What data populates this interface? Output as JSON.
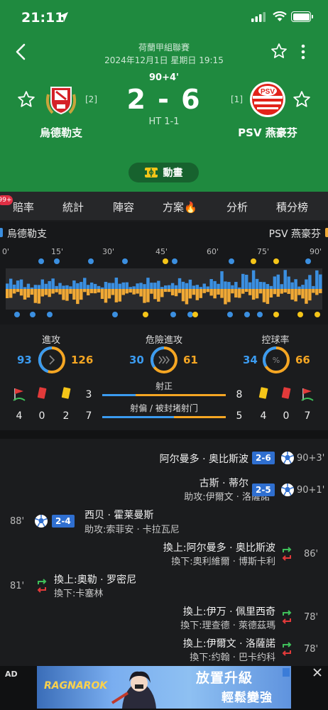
{
  "status_bar": {
    "time": "21:11"
  },
  "match": {
    "competition": "荷蘭甲組聯賽",
    "datetime": "2024年12月1日 星期日 19:15",
    "minute": "90+4'",
    "score": "2 - 6",
    "halftime": "HT 1-1",
    "home": {
      "name": "烏德勒支",
      "rank": "[2]"
    },
    "away": {
      "name": "PSV 燕豪芬",
      "rank": "[1]"
    },
    "animation_label": "動畫"
  },
  "tabs": {
    "badge": "99+",
    "items": [
      "賠率",
      "統計",
      "陣容",
      "方案🔥",
      "分析",
      "積分榜"
    ]
  },
  "timeline": {
    "home_label": "烏德勒支",
    "away_label": "PSV 燕豪芬",
    "ticks": [
      "0'",
      "15'",
      "30'",
      "45'",
      "60'",
      "75'",
      "90'"
    ]
  },
  "stats": {
    "attack": {
      "label": "進攻",
      "home": "93",
      "away": "126"
    },
    "dangerous": {
      "label": "危險進攻",
      "home": "30",
      "away": "61"
    },
    "possession": {
      "label": "控球率",
      "home": "34",
      "away": "66"
    },
    "on_target": {
      "label": "射正",
      "home": "3",
      "away": "8",
      "home_share": 0.27
    },
    "off_target": {
      "label": "射偏 / 被封堵射门",
      "home": "7",
      "away": "5",
      "home_share": 0.58
    },
    "home_cards": {
      "corners": "4",
      "red": "0",
      "yellow": "2"
    },
    "away_cards": {
      "corners": "4",
      "red": "0",
      "yellow": "7"
    }
  },
  "events": [
    {
      "side": "away",
      "type": "goal",
      "player": "阿尔曼多 · 奥比斯波",
      "score": "2-6",
      "minute": "90+3'"
    },
    {
      "side": "away",
      "type": "goal",
      "player": "古斯 · 蒂尔",
      "assist": "助攻:伊爾文 · 洛薩諾",
      "score": "2-5",
      "minute": "90+1'"
    },
    {
      "side": "home",
      "type": "goal",
      "player": "西贝 · 霍莱曼斯",
      "assist": "助攻:索菲安 · 卡拉瓦尼",
      "score": "2-4",
      "minute": "88'"
    },
    {
      "side": "away",
      "type": "sub",
      "player": "換上:阿尔曼多 · 奥比斯波",
      "out": "換下:奧利維爾 · 博斯卡利",
      "minute": "86'"
    },
    {
      "side": "home",
      "type": "sub",
      "player": "換上:奧勒 · 罗密尼",
      "out": "換下:卡塞林",
      "minute": "81'"
    },
    {
      "side": "away",
      "type": "sub",
      "player": "換上:伊万 · 佩里西奇",
      "out": "換下:理查德 · 萊德茲瑪",
      "minute": "78'"
    },
    {
      "side": "away",
      "type": "sub",
      "player": "換上:伊爾文 · 洛薩諾",
      "out": "換下:约翰 · 巴卡约科",
      "minute": "78'"
    }
  ],
  "ad": {
    "label": "AD",
    "game": "RAGNAROK",
    "line1": "放置升級",
    "line2": "輕鬆變強"
  },
  "colors": {
    "header_green": "#1f8a3f",
    "home_blue": "#3b9bf0",
    "away_orange": "#f5a623",
    "score_badge": "#2f6fd0"
  }
}
